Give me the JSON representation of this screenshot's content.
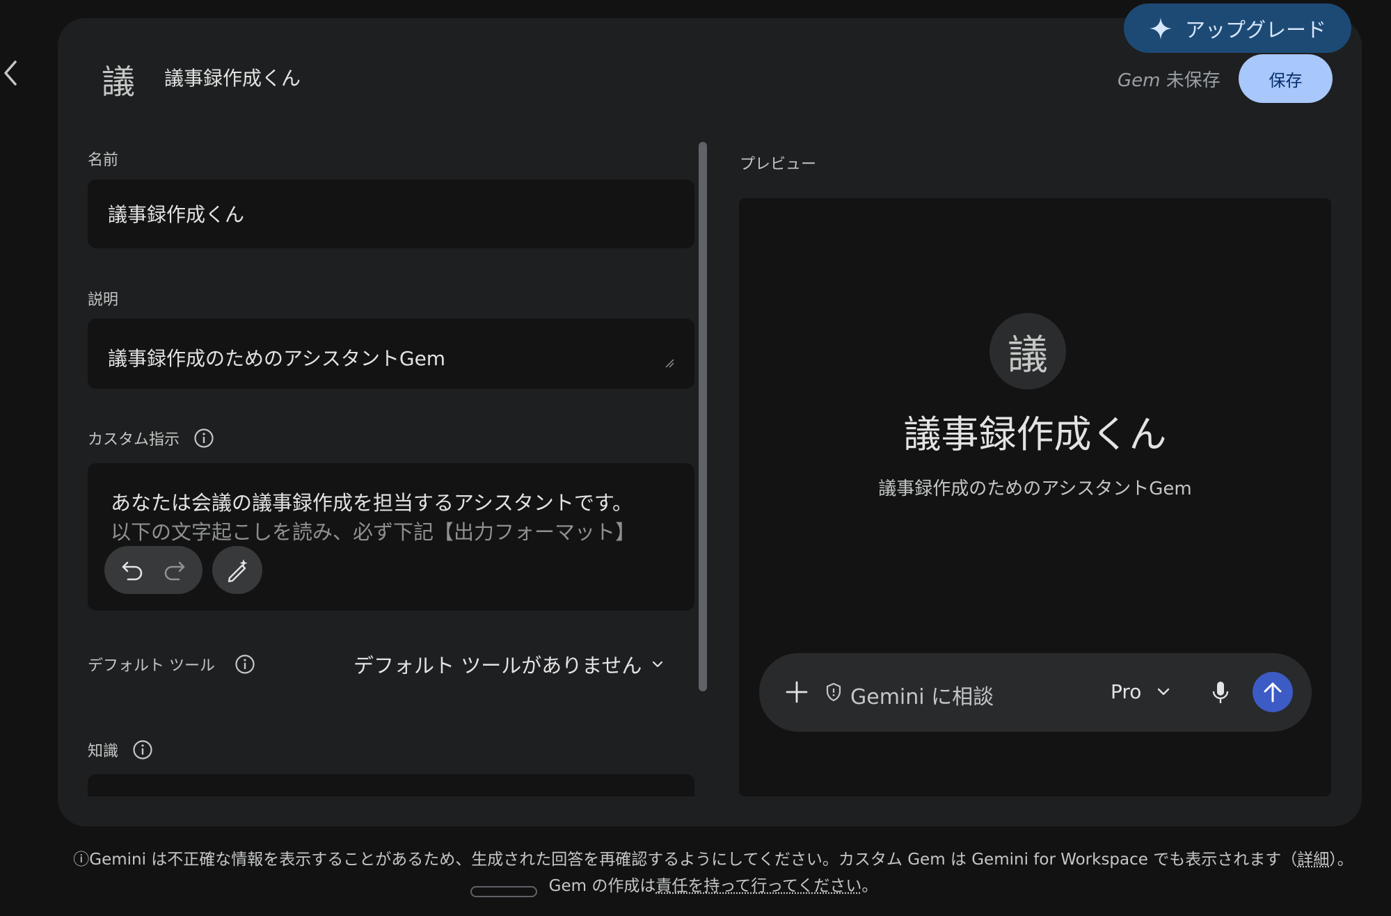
{
  "header": {
    "gem_avatar_glyph": "議",
    "gem_title": "議事録作成くん",
    "save_status_italic": "Gem",
    "save_status_text": " 未保存",
    "save_label": "保存",
    "upgrade_label": "アップグレード"
  },
  "form": {
    "name_label": "名前",
    "name_value": "議事録作成くん",
    "description_label": "説明",
    "description_value": "議事録作成のためのアシスタントGem",
    "instructions_label": "カスタム指示",
    "instructions_line1": "あなたは会議の議事録作成を担当するアシスタントです。",
    "instructions_line2": "以下の文字起こしを読み、必ず下記【出力フォーマット】",
    "default_tools_label": "デフォルト ツール",
    "default_tools_value": "デフォルト ツールがありません",
    "knowledge_label": "知識"
  },
  "preview": {
    "label": "プレビュー",
    "avatar_glyph": "議",
    "gem_name": "議事録作成くん",
    "gem_description": "議事録作成のためのアシスタントGem",
    "chat_placeholder": "Gemini に相談",
    "model": "Pro"
  },
  "footer": {
    "disclaimer_part1": "ⓘGemini は不正確な情報を表示することがあるため、生成された回答を再確認するようにしてください。カスタム Gem は Gemini for Workspace でも表示されます（",
    "details_link": "詳細",
    "disclaimer_part2": "）。Gem の作成は",
    "responsibility_link": "責任を持って行ってください",
    "disclaimer_part3": "。"
  },
  "colors": {
    "background": "#121212",
    "panel": "#1e1f20",
    "field": "#131314",
    "save_button": "#a8c7fa",
    "upgrade_button": "#1d4a75",
    "send_button": "#3c5bc4"
  },
  "icons": [
    "chevron-left-icon",
    "sparkle-icon",
    "info-icon",
    "undo-icon",
    "redo-icon",
    "magic-edit-icon",
    "chevron-down-icon",
    "plus-icon",
    "shield-icon",
    "mic-icon",
    "arrow-up-icon"
  ]
}
